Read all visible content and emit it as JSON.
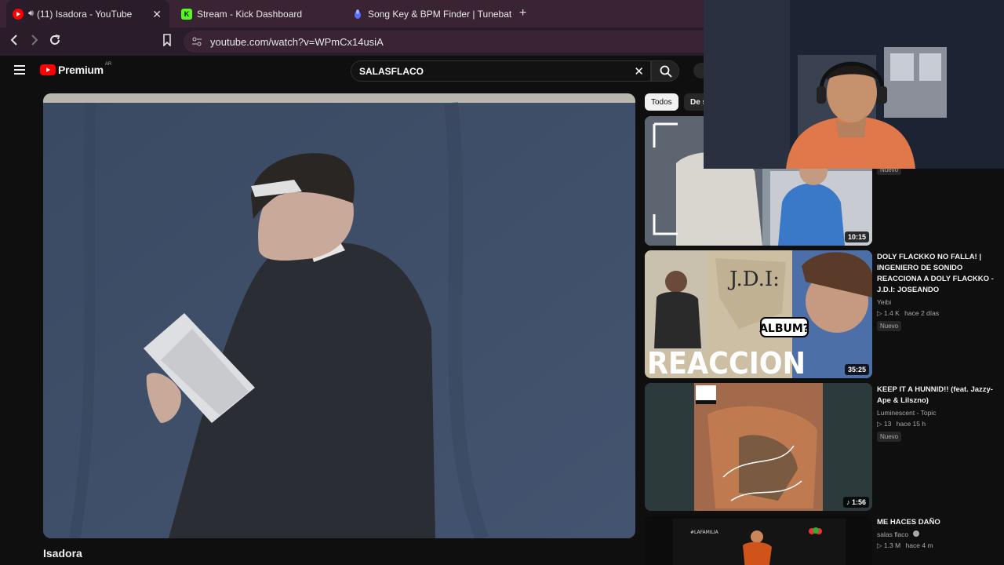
{
  "browser": {
    "tabs": [
      {
        "label": "(11) Isadora - YouTube",
        "icon": "youtube-favicon",
        "active": true
      },
      {
        "label": "Stream - Kick Dashboard",
        "icon": "kick-favicon"
      },
      {
        "label": "Song Key & BPM Finder | Tunebat",
        "icon": "tunebat-favicon"
      }
    ],
    "url": "youtube.com/watch?v=WPmCx14usiA"
  },
  "youtube": {
    "logo_text": "Premium",
    "region": "AR",
    "search_query": "SALASFLACO",
    "video_title": "Isadora"
  },
  "chips": [
    "Todos",
    "De s"
  ],
  "recommendations": [
    {
      "duration": "10:15",
      "tag": "Nuevo"
    },
    {
      "title": "DOLY FLACKKO NO FALLA! | INGENIERO DE SONIDO REACCIONA A DOLY FLACKKO - J.D.I: JOSEANDO",
      "channel": "Yeibi",
      "views": "1.4 K",
      "age": "hace 2 días",
      "tag": "Nuevo",
      "duration": "35:25",
      "thumb_text": "REACCION",
      "thumb_title": "J.D.I:",
      "thumb_bubble": "ALBUM?"
    },
    {
      "title": "KEEP IT A HUNNID!! (feat. Jazzy-Ape & Lilszno)",
      "channel": "Luminescent - Topic",
      "views": "13",
      "age": "hace 15 h",
      "tag": "Nuevo",
      "duration": "1:56"
    },
    {
      "title": "ME HACES DAÑO",
      "channel": "salas flaco",
      "views": "1.3 M",
      "age": "hace 4 m",
      "thumb_text": "#LAFAMILIA"
    }
  ],
  "colors": {
    "yt_red": "#ff0000",
    "browser_bg": "#3a2434",
    "page_bg": "#0f0f0f"
  }
}
